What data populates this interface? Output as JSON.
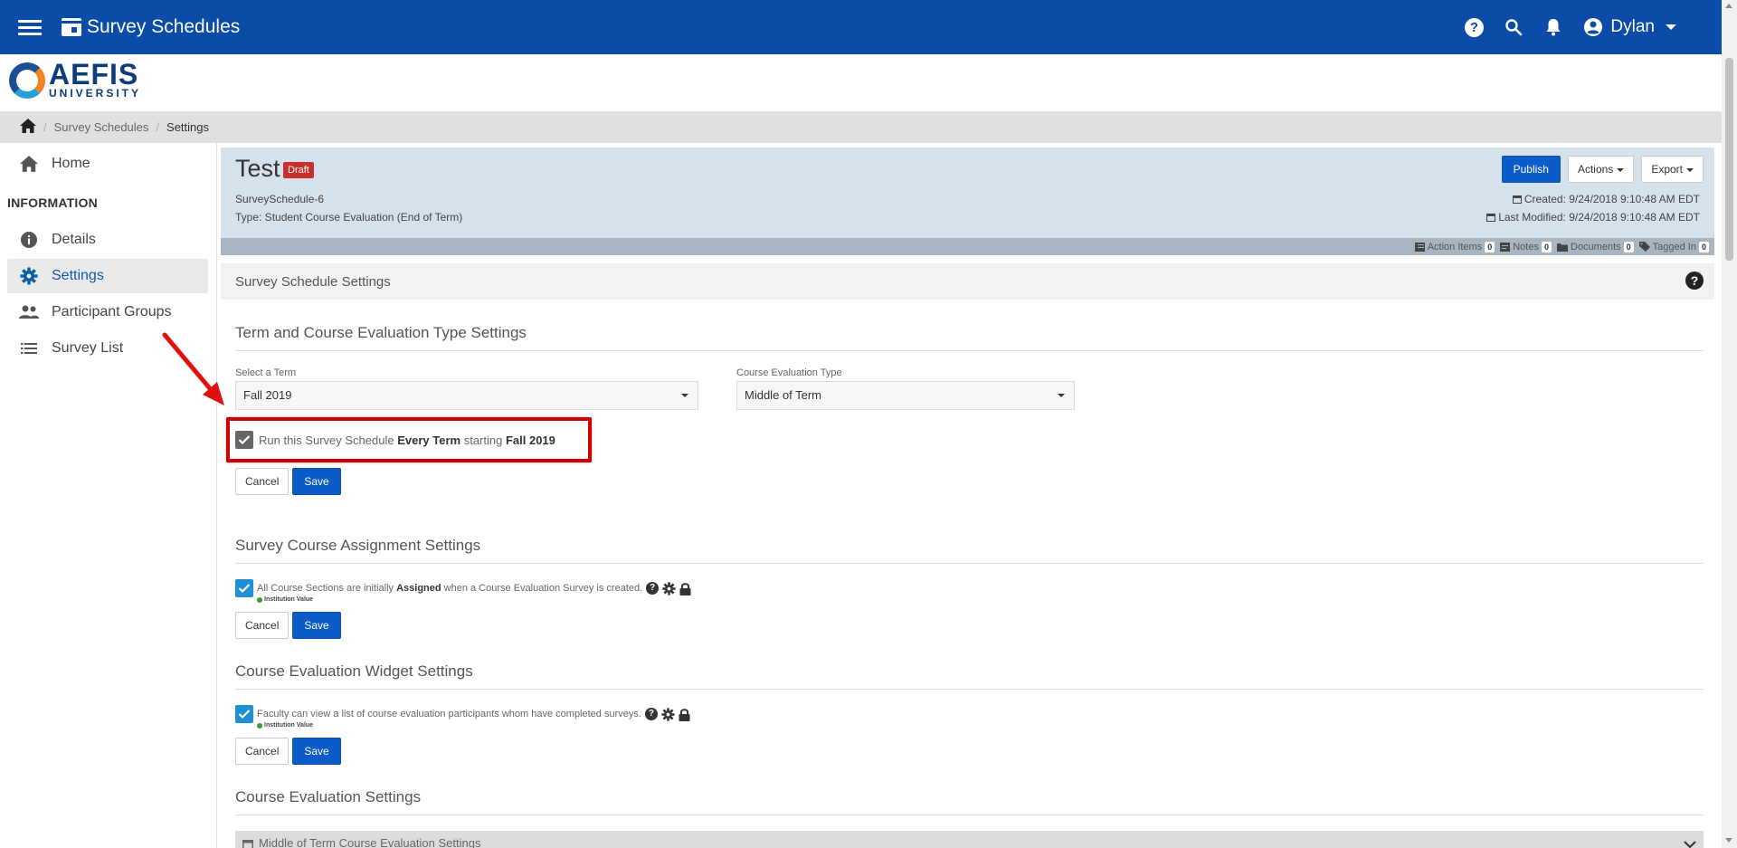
{
  "app": {
    "title": "Survey Schedules",
    "user_name": "Dylan"
  },
  "logo": {
    "word": "AEFIS",
    "sub": "UNIVERSITY"
  },
  "breadcrumb": {
    "items": [
      "Survey Schedules",
      "Settings"
    ]
  },
  "sidebar": {
    "home": "Home",
    "section": "INFORMATION",
    "items": [
      {
        "label": "Details",
        "icon": "info-icon"
      },
      {
        "label": "Settings",
        "icon": "gear-icon"
      },
      {
        "label": "Participant Groups",
        "icon": "people-icon"
      },
      {
        "label": "Survey List",
        "icon": "list-icon"
      }
    ]
  },
  "header": {
    "title": "Test",
    "badge": "Draft",
    "id": "SurveySchedule-6",
    "type": "Type: Student Course Evaluation (End of Term)",
    "created": "Created: 9/24/2018 9:10:48 AM EDT",
    "modified": "Last Modified: 9/24/2018 9:10:48 AM EDT",
    "publish": "Publish",
    "actions": "Actions",
    "export": "Export"
  },
  "strip": {
    "action_items": "Action Items",
    "action_items_count": "0",
    "notes": "Notes",
    "notes_count": "0",
    "documents": "Documents",
    "documents_count": "0",
    "tagged": "Tagged In",
    "tagged_count": "0"
  },
  "panel": {
    "title": "Survey Schedule Settings",
    "help": "?"
  },
  "term_section": {
    "title": "Term and Course Evaluation Type Settings",
    "term_label": "Select a Term",
    "term_value": "Fall 2019",
    "type_label": "Course Evaluation Type",
    "type_value": "Middle of Term",
    "check_pre": "Run this Survey Schedule",
    "check_bold1": "Every Term",
    "check_mid": "starting",
    "check_bold2": "Fall 2019",
    "cancel": "Cancel",
    "save": "Save"
  },
  "assign_section": {
    "title": "Survey Course Assignment Settings",
    "check_pre": "All Course Sections are initially",
    "check_bold": "Assigned",
    "check_post": "when a Course Evaluation Survey is created.",
    "inst": "Institution Value",
    "cancel": "Cancel",
    "save": "Save"
  },
  "widget_section": {
    "title": "Course Evaluation Widget Settings",
    "check_text": "Faculty can view a list of course evaluation participants whom have completed surveys.",
    "inst": "Institution Value",
    "cancel": "Cancel",
    "save": "Save"
  },
  "eval_section": {
    "title": "Course Evaluation Settings",
    "accordion": "Middle of Term Course Evaluation Settings"
  },
  "colors": {
    "topbar": "#0b4ca8",
    "primary": "#0b5cc9",
    "highlight": "#cc0000"
  }
}
